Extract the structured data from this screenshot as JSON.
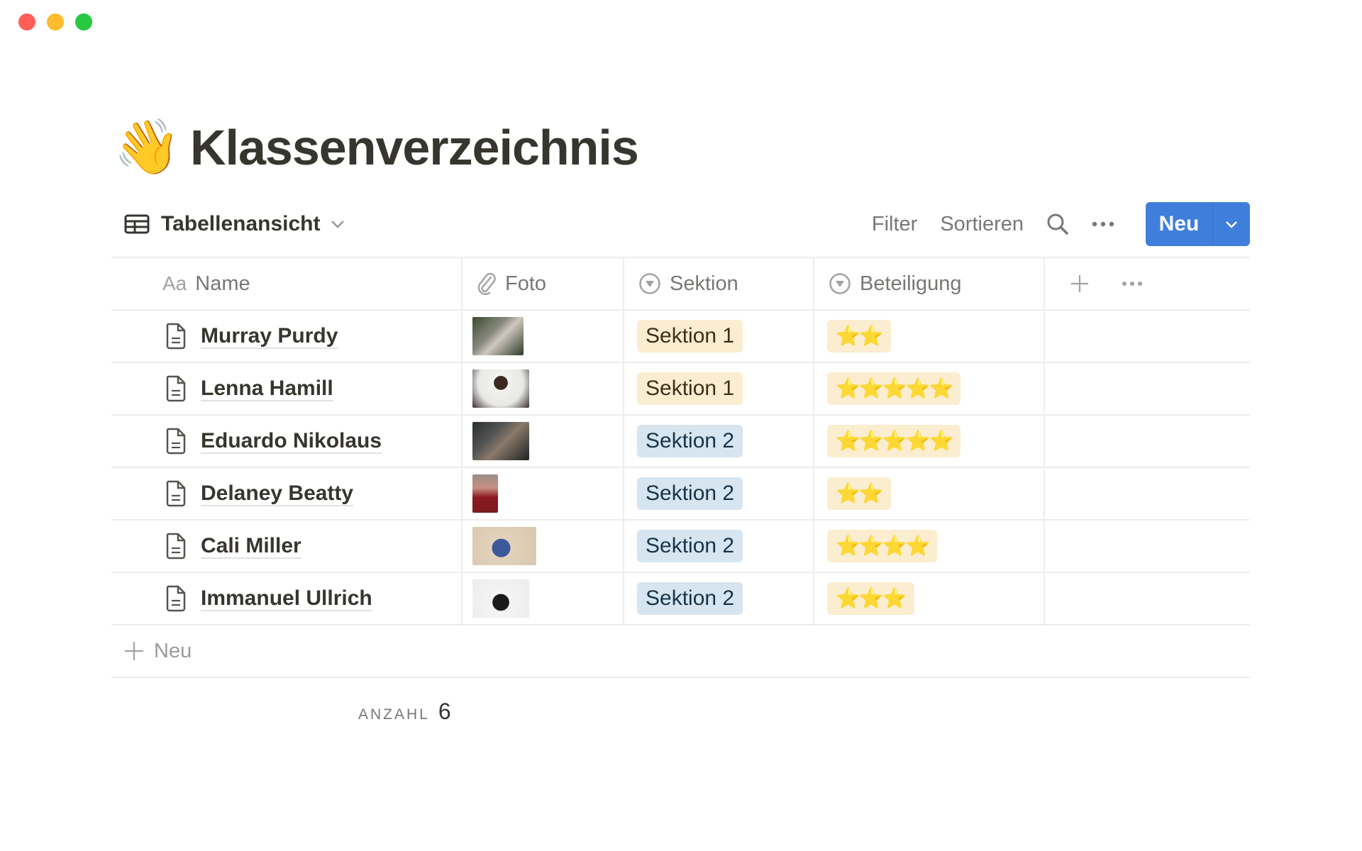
{
  "window": {
    "controls": [
      "close",
      "minimize",
      "maximize"
    ]
  },
  "page": {
    "emoji": "👋",
    "title": "Klassenverzeichnis"
  },
  "toolbar": {
    "view_label": "Tabellenansicht",
    "filter_label": "Filter",
    "sort_label": "Sortieren",
    "new_label": "Neu"
  },
  "table": {
    "columns": [
      {
        "label": "Name",
        "prefix": "Aa",
        "icon": "text-icon"
      },
      {
        "label": "Foto",
        "icon": "paperclip-icon"
      },
      {
        "label": "Sektion",
        "icon": "select-icon"
      },
      {
        "label": "Beteiligung",
        "icon": "select-icon"
      }
    ],
    "rows": [
      {
        "name": "Murray Purdy",
        "photo": "photo-thumbnail",
        "section": "Sektion 1",
        "section_color": "yellow",
        "participation": "⭐⭐",
        "stars": 2
      },
      {
        "name": "Lenna Hamill",
        "photo": "photo-thumbnail",
        "section": "Sektion 1",
        "section_color": "yellow",
        "participation": "⭐⭐⭐⭐⭐",
        "stars": 5
      },
      {
        "name": "Eduardo Nikolaus",
        "photo": "photo-thumbnail",
        "section": "Sektion 2",
        "section_color": "blue",
        "participation": "⭐⭐⭐⭐⭐",
        "stars": 5
      },
      {
        "name": "Delaney Beatty",
        "photo": "photo-thumbnail",
        "section": "Sektion 2",
        "section_color": "blue",
        "participation": "⭐⭐",
        "stars": 2
      },
      {
        "name": "Cali Miller",
        "photo": "photo-thumbnail",
        "section": "Sektion 2",
        "section_color": "blue",
        "participation": "⭐⭐⭐⭐",
        "stars": 4
      },
      {
        "name": "Immanuel Ullrich",
        "photo": "photo-thumbnail",
        "section": "Sektion 2",
        "section_color": "blue",
        "participation": "⭐⭐⭐",
        "stars": 3
      }
    ],
    "add_row_label": "Neu"
  },
  "footer": {
    "count_label": "ANZAHL",
    "count_value": "6"
  },
  "colors": {
    "accent": "#3f7fdb",
    "tag_yellow_bg": "#fbedd0",
    "tag_blue_bg": "#d6e5f0"
  }
}
